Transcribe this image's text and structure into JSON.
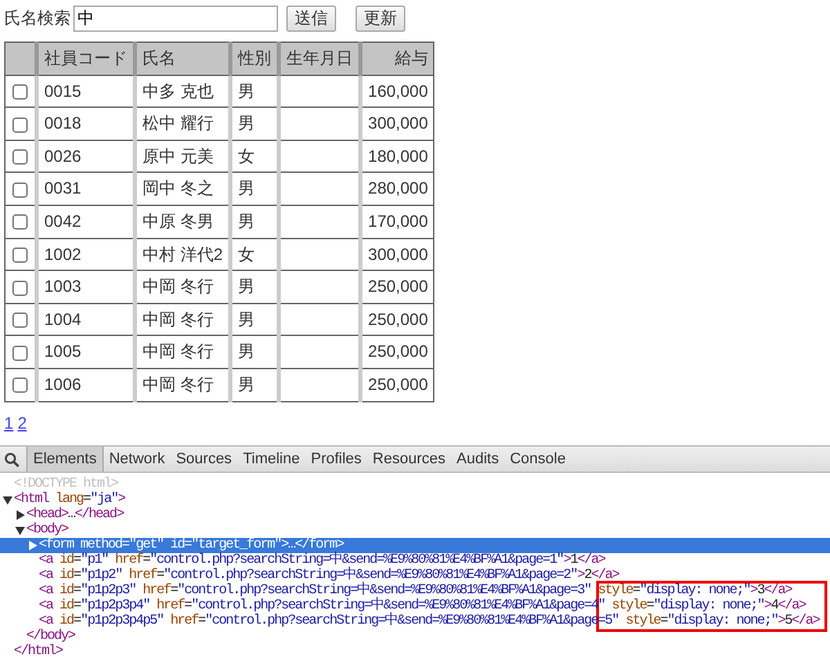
{
  "search": {
    "label": "氏名検索",
    "value": "中"
  },
  "buttons": [
    "送信",
    "更新"
  ],
  "table": {
    "columns": [
      "社員コード",
      "氏名",
      "性別",
      "生年月日",
      "給与"
    ],
    "rows": [
      {
        "checked": false,
        "code": "0015",
        "name": "中多 克也",
        "sex": "男",
        "salary": "160,000"
      },
      {
        "checked": false,
        "code": "0018",
        "name": "松中 耀行",
        "sex": "男",
        "salary": "300,000"
      },
      {
        "checked": false,
        "code": "0026",
        "name": "原中 元美",
        "sex": "女",
        "salary": "180,000"
      },
      {
        "checked": false,
        "code": "0031",
        "name": "岡中 冬之",
        "sex": "男",
        "salary": "280,000"
      },
      {
        "checked": false,
        "code": "0042",
        "name": "中原 冬男",
        "sex": "男",
        "salary": "170,000"
      },
      {
        "checked": false,
        "code": "1002",
        "name": "中村 洋代2",
        "sex": "女",
        "salary": "300,000"
      },
      {
        "checked": false,
        "code": "1003",
        "name": "中岡 冬行",
        "sex": "男",
        "salary": "250,000"
      },
      {
        "checked": false,
        "code": "1004",
        "name": "中岡 冬行",
        "sex": "男",
        "salary": "250,000"
      },
      {
        "checked": false,
        "code": "1005",
        "name": "中岡 冬行",
        "sex": "男",
        "salary": "250,000"
      },
      {
        "checked": false,
        "code": "1006",
        "name": "中岡 冬行",
        "sex": "男",
        "salary": "250,000"
      }
    ]
  },
  "pagination": [
    "1",
    "2"
  ],
  "devtools": {
    "tabs": [
      {
        "label": "Elements",
        "selected": true
      },
      {
        "label": "Network",
        "selected": false
      },
      {
        "label": "Sources",
        "selected": false
      },
      {
        "label": "Timeline",
        "selected": false
      },
      {
        "label": "Profiles",
        "selected": false
      },
      {
        "label": "Resources",
        "selected": false
      },
      {
        "label": "Audits",
        "selected": false
      },
      {
        "label": "Console",
        "selected": false
      }
    ],
    "dom": [
      {
        "kind": "doctype",
        "text": "<!DOCTYPE html>",
        "selected": false
      },
      {
        "kind": "element",
        "text": "<html lang=\"ja\">",
        "expanded": true,
        "selected": false,
        "close": "</html>",
        "children": [
          {
            "kind": "element",
            "text": "<head>…</head>",
            "expanded": false,
            "selected": false
          },
          {
            "kind": "element",
            "text": "<body>",
            "expanded": true,
            "selected": false,
            "close": "</body>",
            "children": [
              {
                "kind": "element",
                "text": "<form method=\"get\" id=\"target_form\">…</form>",
                "expanded": false,
                "selected": true
              },
              {
                "kind": "element",
                "text": "<a id=\"p1\" href=\"control.php?searchString=中&send=%E9%80%81%E4%BF%A1&page=1\">1</a>",
                "selected": false
              },
              {
                "kind": "element",
                "text": "<a id=\"p1p2\" href=\"control.php?searchString=中&send=%E9%80%81%E4%BF%A1&page=2\">2</a>",
                "selected": false
              },
              {
                "kind": "element",
                "text": "<a id=\"p1p2p3\" href=\"control.php?searchString=中&send=%E9%80%81%E4%BF%A1&page=3\" style=\"display: none;\">3</a>",
                "selected": false
              },
              {
                "kind": "element",
                "text": "<a id=\"p1p2p3p4\" href=\"control.php?searchString=中&send=%E9%80%81%E4%BF%A1&page=4\" style=\"display: none;\">4</a>",
                "selected": false
              },
              {
                "kind": "element",
                "text": "<a id=\"p1p2p3p4p5\" href=\"control.php?searchString=中&send=%E9%80%81%E4%BF%A1&page=5\" style=\"display: none;\">5</a>",
                "selected": false
              }
            ]
          }
        ]
      }
    ]
  }
}
